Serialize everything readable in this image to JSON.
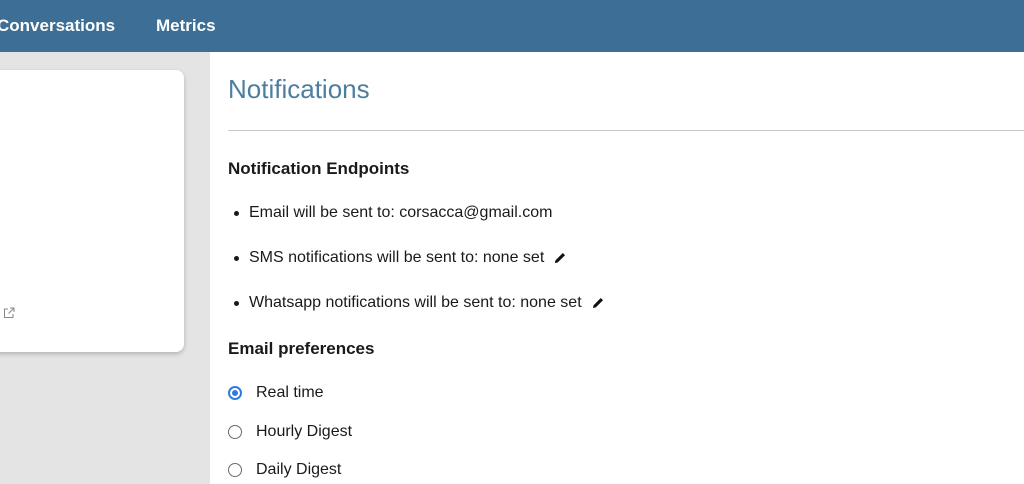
{
  "nav": {
    "items": [
      {
        "label": "Conversations"
      },
      {
        "label": "Metrics"
      }
    ]
  },
  "page": {
    "title": "Notifications"
  },
  "endpoints": {
    "heading": "Notification Endpoints",
    "items": [
      {
        "text": "Email will be sent to: corsacca@gmail.com",
        "editable": false
      },
      {
        "text": "SMS notifications will be sent to: none set",
        "editable": true,
        "icon": "pencil-icon"
      },
      {
        "text": "Whatsapp notifications will be sent to: none set",
        "editable": true,
        "icon": "pencil-icon"
      }
    ]
  },
  "email_prefs": {
    "heading": "Email preferences",
    "options": [
      {
        "label": "Real time",
        "checked": true
      },
      {
        "label": "Hourly Digest",
        "checked": false
      },
      {
        "label": "Daily Digest",
        "checked": false
      }
    ]
  },
  "colors": {
    "nav_bg": "#3d6f96",
    "title": "#4c7e9e",
    "radio_accent": "#2d7be0"
  },
  "icons": {
    "left_card": "external-link-icon"
  }
}
